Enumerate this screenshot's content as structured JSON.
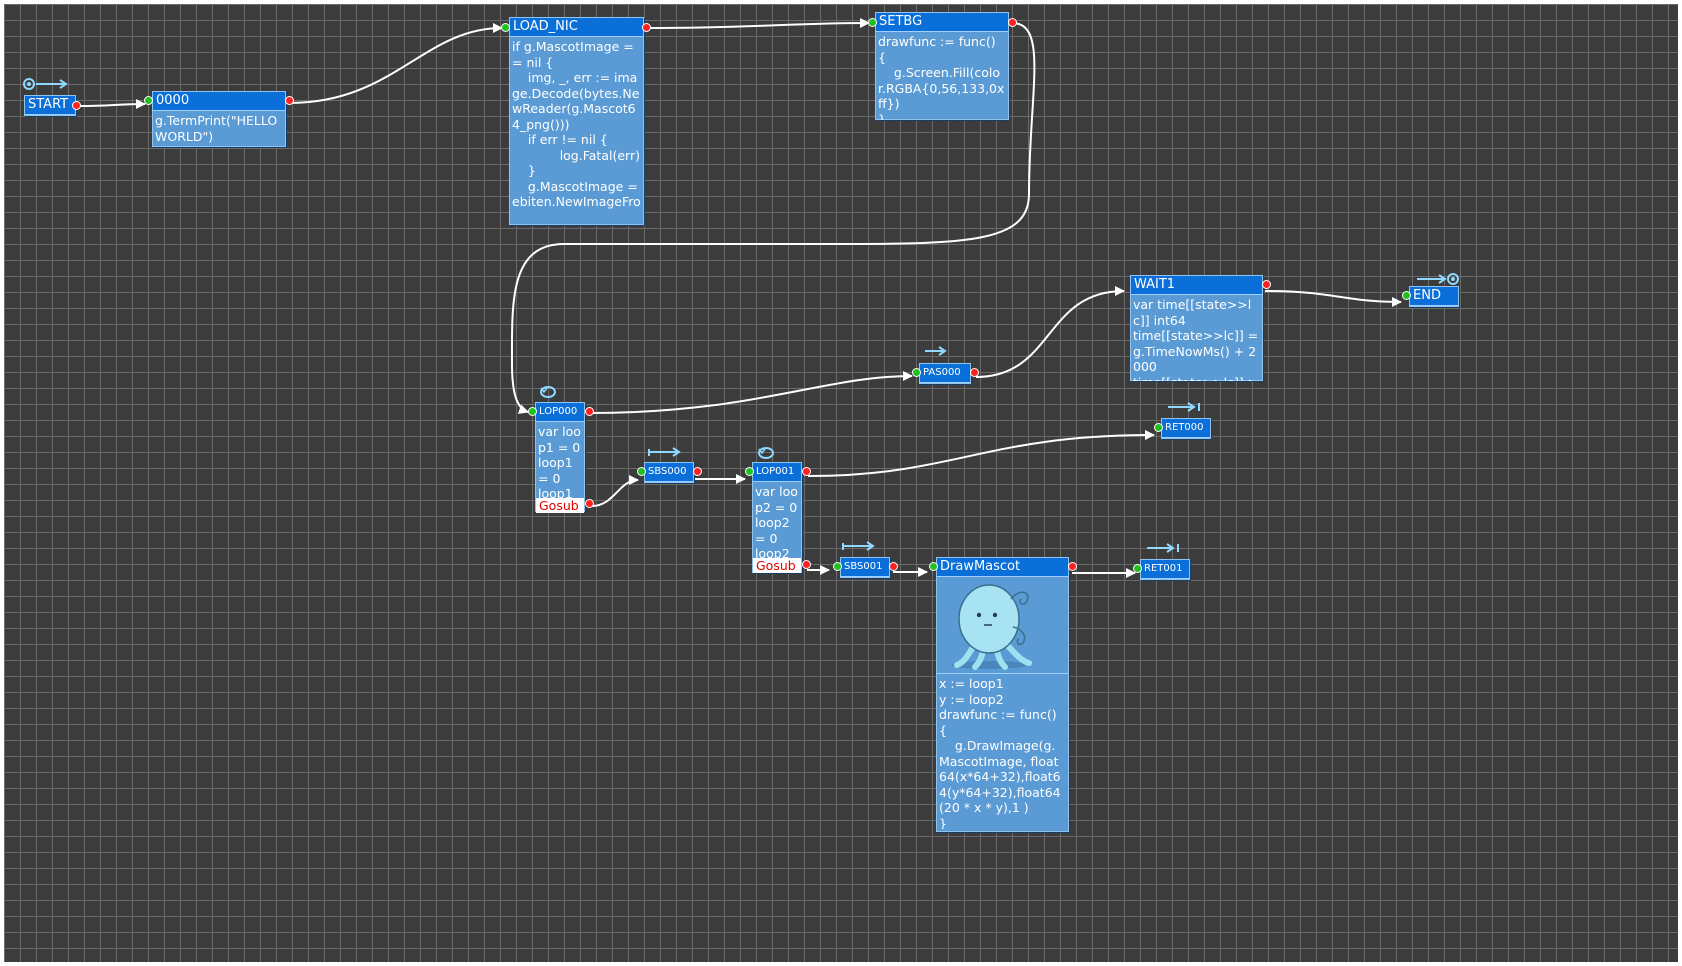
{
  "nodes": {
    "start": {
      "title": "START"
    },
    "n0000": {
      "title": "0000",
      "body": "g.TermPrint(\"HELLO WORLD\")"
    },
    "load_nic": {
      "title": "LOAD_NIC",
      "body": "if g.MascotImage == nil {\n    img, _, err := image.Decode(bytes.NewReader(g.Mascot64_png()))\n    if err != nil {\n            log.Fatal(err)\n    }\n    g.MascotImage = ebiten.NewImageFro"
    },
    "setbg": {
      "title": "SETBG",
      "body": "drawfunc := func() {\n    g.Screen.Fill(color.RGBA{0,56,133,0xff})\n}\ng.AddDrawBg(drawfunc)"
    },
    "wait1": {
      "title": "WAIT1",
      "body": "var time[[state>>lc]] int64\ntime[[state>>lc]] = g.TimeNowMs() + 2000\ntime[[state>>lc]] > g.TimeNowMs()"
    },
    "end": {
      "title": "END"
    },
    "pas000": {
      "title": "PAS000"
    },
    "lop000": {
      "title": "LOP000",
      "body": "var loop1 = 0\nloop1 = 0\nloop1",
      "gosub": "Gosub"
    },
    "ret000": {
      "title": "RET000"
    },
    "sbs000": {
      "title": "SBS000"
    },
    "lop001": {
      "title": "LOP001",
      "body": "var loop2 = 0\nloop2 = 0\nloop2",
      "gosub": "Gosub"
    },
    "sbs001": {
      "title": "SBS001"
    },
    "drawmascot": {
      "title": "DrawMascot",
      "body": "x := loop1\ny := loop2\ndrawfunc := func() {\n    g.DrawImage(g.MascotImage, float64(x*64+32),float64(y*64+32),float64(20 * x * y),1 )\n}\ng.AddDrawStage(drawfunc)"
    },
    "ret001": {
      "title": "RET001"
    }
  },
  "colors": {
    "node_fill": "#5b9bd5",
    "node_title": "#0a6fd8",
    "wire": "#ffffff",
    "out_port": "#ff2020",
    "in_port": "#20c020",
    "gosub_text": "#e00000",
    "canvas": "#3c3c3c",
    "icon": "#8fd8ff"
  },
  "icons": [
    "start-flag-icon",
    "end-flag-icon",
    "loop-icon",
    "pass-icon",
    "subroutine-icon",
    "return-icon",
    "mascot-image"
  ]
}
